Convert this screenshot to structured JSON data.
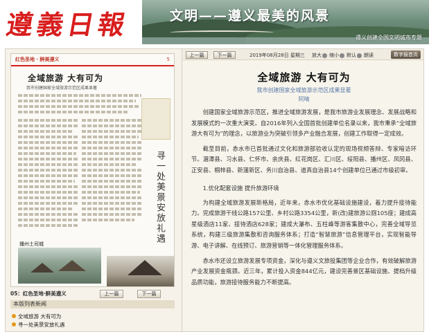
{
  "masthead": {
    "logo": "遵義日報",
    "banner_title": "文明——遵义最美的风景",
    "banner_sub": "遵义创建全国文明城市专题"
  },
  "left": {
    "scan": {
      "column_tag": "红色圣地 · 醉美遵义",
      "page_num": "5",
      "headline": "全域旅游 大有可为",
      "subhead": "我市创建国家全域旅游示范区成果显著",
      "vertical_text": "寻一处美景安放礼遇",
      "photo_caption": "播州土司城"
    },
    "page_label": "05：红色圣地·醉美遵义",
    "prev_label": "上一篇",
    "next_label": "下一篇",
    "list_header": "本版列表新闻",
    "articles": [
      "全域旅游 大有可为",
      "寻一处美景安放礼遇"
    ]
  },
  "toolbar": {
    "prev_label": "上一篇",
    "next_label": "下一篇",
    "date": "2019年08月28日 星期三",
    "zoom_in": "放大",
    "zoom_out": "缩小",
    "zoom_default": "默认",
    "read_label": "朗读",
    "digital_label": "数字报首页"
  },
  "article": {
    "title": "全域旅游 大有可为",
    "subtitle": "我市创建国家全域旅游示范区成果显著",
    "author": "阿晴",
    "paragraphs": [
      "创建国家全域旅游示范区，推进全域旅游发展，是我市旅游业发展理念、发展战略和发展模式的一次重大演变。自2016年列入全国首批创建单位名录以来，我市秉承“全域旅游大有可为”的理念，以旅游业为突破引领多产业融合发展，创建工作取得一定成效。",
      "截至目前，赤水市已首批通过文化和旅游部验收认定的现场视频答辩、专家暗访环节。湄潭县、习水县、仁怀市、余庆县、红花岗区、汇川区、绥阳县、播州区、凤冈县、正安县、桐梓县、新蒲新区、务川自治县、道真自治县14个创建单位已通过市级初审。",
      "1.优化配套设施 提升旅游环境",
      "为构建全域旅游发展新格局，近年来，赤水市优化基础设施建设，着力提升接待能力。完成旅游干线公路157公里、乡村公路3354公里，新(改)建旅游公厕105座；建成高星级酒店11家、接待酒店628家；建成大瀑布、五柱峰等游客集散中心，完善全域导览系统，构建三级旅游集散和咨询服务体系；打造“智慧旅游”信息管理平台，实现智能导游、电子讲解、在线预订、旅游营销等一体化管理服务体系。",
      "赤水市还设立旅游发展专项资金，深化与遵义文旅投集团等企业合作，有效破解旅游产业发展资金瓶颈。近三年，累计投入资金844亿元，建设完善景区基础设施、提档升级品质功能，旅游接待服务能力不断提高。"
    ]
  },
  "colors": {
    "logo_red": "#d81e1e",
    "subtitle_blue": "#5a79a8",
    "bullet_orange": "#e29a1a"
  }
}
